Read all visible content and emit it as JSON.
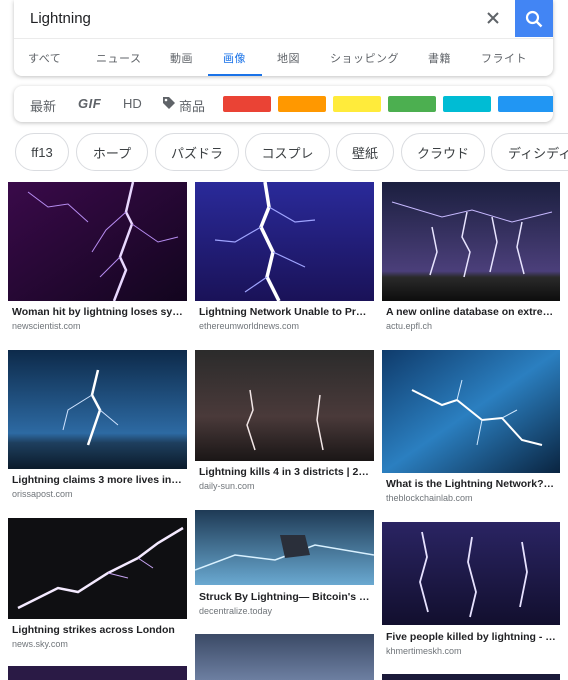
{
  "search": {
    "query": "Lightning"
  },
  "tabs": [
    {
      "label": "すべて"
    },
    {
      "label": "ニュース"
    },
    {
      "label": "動画"
    },
    {
      "label": "画像"
    },
    {
      "label": "地図"
    },
    {
      "label": "ショッピング"
    },
    {
      "label": "書籍"
    },
    {
      "label": "フライト"
    }
  ],
  "active_tab": "画像",
  "filters": {
    "recent": "最新",
    "gif": "GIF",
    "hd": "HD",
    "product": "商品",
    "colors": [
      "#ea4335",
      "#ff9800",
      "#ffeb3b",
      "#4caf50",
      "#00bcd4",
      "#2196f3"
    ]
  },
  "chips": [
    "ff13",
    "ホープ",
    "パズドラ",
    "コスプレ",
    "壁紙",
    "クラウド",
    "ディシディア"
  ],
  "results": [
    {
      "title": "Woman hit by lightning loses syn...",
      "source": "newscientist.com"
    },
    {
      "title": "Lightning Network Unable to Proc...",
      "source": "ethereumworldnews.com"
    },
    {
      "title": "A new online database on extrem...",
      "source": "actu.epfl.ch"
    },
    {
      "title": "Lightning claims 3 more lives in s...",
      "source": "orissapost.com"
    },
    {
      "title": "Lightning kills 4 in 3 districts | 20...",
      "source": "daily-sun.com"
    },
    {
      "title": "What is the Lightning Network? - ...",
      "source": "theblockchainlab.com"
    },
    {
      "title": "Lightning strikes across London",
      "source": "news.sky.com"
    },
    {
      "title": "Struck By Lightning— Bitcoin's Tr...",
      "source": "decentralize.today"
    },
    {
      "title": "Five people killed by lightning - K...",
      "source": "khmertimeskh.com"
    }
  ]
}
